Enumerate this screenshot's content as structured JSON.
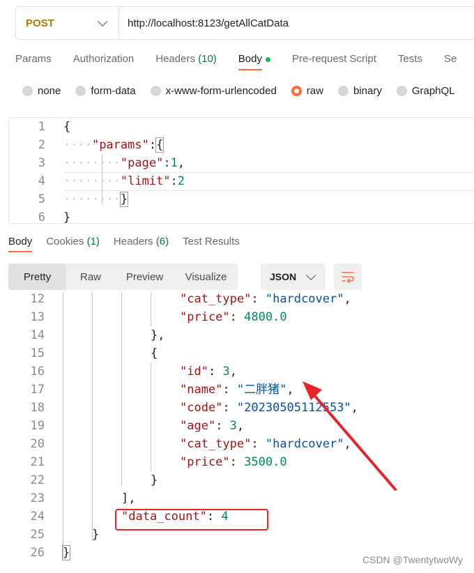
{
  "url_bar": {
    "method": "POST",
    "url": "http://localhost:8123/getAllCatData"
  },
  "request_tabs": [
    {
      "label": "Params"
    },
    {
      "label": "Authorization"
    },
    {
      "label": "Headers",
      "count": "(10)"
    },
    {
      "label": "Body",
      "active": true
    },
    {
      "label": "Pre-request Script"
    },
    {
      "label": "Tests"
    },
    {
      "label": "Se"
    }
  ],
  "body_types": [
    {
      "label": "none"
    },
    {
      "label": "form-data"
    },
    {
      "label": "x-www-form-urlencoded"
    },
    {
      "label": "raw",
      "selected": true
    },
    {
      "label": "binary"
    },
    {
      "label": "GraphQL"
    }
  ],
  "request_body": {
    "lines": [
      {
        "n": "1",
        "ws": "",
        "tokens": [
          [
            "p",
            "{"
          ]
        ]
      },
      {
        "n": "2",
        "ws": "····",
        "tokens": [
          [
            "k",
            "\"params\""
          ],
          [
            "p",
            ":"
          ],
          [
            "p",
            "{"
          ]
        ]
      },
      {
        "n": "3",
        "ws": "········",
        "tokens": [
          [
            "k",
            "\"page\""
          ],
          [
            "p",
            ":"
          ],
          [
            "n",
            "1"
          ],
          [
            "p",
            ","
          ]
        ]
      },
      {
        "n": "4",
        "ws": "········",
        "tokens": [
          [
            "k",
            "\"limit\""
          ],
          [
            "p",
            ":"
          ],
          [
            "n",
            "2"
          ]
        ]
      },
      {
        "n": "5",
        "ws": "········",
        "tokens": [
          [
            "p",
            "}"
          ]
        ]
      },
      {
        "n": "6",
        "ws": "",
        "tokens": [
          [
            "p",
            "}"
          ]
        ]
      }
    ]
  },
  "response_tabs": [
    {
      "label": "Body",
      "active": true
    },
    {
      "label": "Cookies",
      "count": "(1)"
    },
    {
      "label": "Headers",
      "count": "(6)"
    },
    {
      "label": "Test Results"
    }
  ],
  "view_modes": [
    "Pretty",
    "Raw",
    "Preview",
    "Visualize"
  ],
  "active_view": "Pretty",
  "format": "JSON",
  "response_body": {
    "lines": [
      {
        "n": "12",
        "indent": 4,
        "tokens": [
          [
            "k",
            "\"cat_type\""
          ],
          [
            "p",
            ": "
          ],
          [
            "s",
            "\"hardcover\""
          ],
          [
            "p",
            ","
          ]
        ]
      },
      {
        "n": "13",
        "indent": 4,
        "tokens": [
          [
            "k",
            "\"price\""
          ],
          [
            "p",
            ": "
          ],
          [
            "n",
            "4800.0"
          ]
        ]
      },
      {
        "n": "14",
        "indent": 3,
        "tokens": [
          [
            "p",
            "},"
          ]
        ]
      },
      {
        "n": "15",
        "indent": 3,
        "tokens": [
          [
            "p",
            "{"
          ]
        ]
      },
      {
        "n": "16",
        "indent": 4,
        "tokens": [
          [
            "k",
            "\"id\""
          ],
          [
            "p",
            ": "
          ],
          [
            "n",
            "3"
          ],
          [
            "p",
            ","
          ]
        ]
      },
      {
        "n": "17",
        "indent": 4,
        "tokens": [
          [
            "k",
            "\"name\""
          ],
          [
            "p",
            ": "
          ],
          [
            "s",
            "\"二胖猪\""
          ],
          [
            "p",
            ","
          ]
        ]
      },
      {
        "n": "18",
        "indent": 4,
        "tokens": [
          [
            "k",
            "\"code\""
          ],
          [
            "p",
            ": "
          ],
          [
            "s",
            "\"20230505112553\""
          ],
          [
            "p",
            ","
          ]
        ]
      },
      {
        "n": "19",
        "indent": 4,
        "tokens": [
          [
            "k",
            "\"age\""
          ],
          [
            "p",
            ": "
          ],
          [
            "n",
            "3"
          ],
          [
            "p",
            ","
          ]
        ]
      },
      {
        "n": "20",
        "indent": 4,
        "tokens": [
          [
            "k",
            "\"cat_type\""
          ],
          [
            "p",
            ": "
          ],
          [
            "s",
            "\"hardcover\""
          ],
          [
            "p",
            ","
          ]
        ]
      },
      {
        "n": "21",
        "indent": 4,
        "tokens": [
          [
            "k",
            "\"price\""
          ],
          [
            "p",
            ": "
          ],
          [
            "n",
            "3500.0"
          ]
        ]
      },
      {
        "n": "22",
        "indent": 3,
        "tokens": [
          [
            "p",
            "}"
          ]
        ]
      },
      {
        "n": "23",
        "indent": 2,
        "tokens": [
          [
            "p",
            "],"
          ]
        ]
      },
      {
        "n": "24",
        "indent": 2,
        "tokens": [
          [
            "k",
            "\"data_count\""
          ],
          [
            "p",
            ": "
          ],
          [
            "n",
            "4"
          ]
        ]
      },
      {
        "n": "25",
        "indent": 1,
        "tokens": [
          [
            "p",
            "}"
          ]
        ]
      },
      {
        "n": "26",
        "indent": 0,
        "tokens": [
          [
            "p",
            "}"
          ]
        ]
      }
    ]
  },
  "watermark": "CSDN @TwentytwoWy",
  "colors": {
    "accent": "#ff6c37",
    "annotation": "#e8232a",
    "method": "#ad7a03"
  }
}
